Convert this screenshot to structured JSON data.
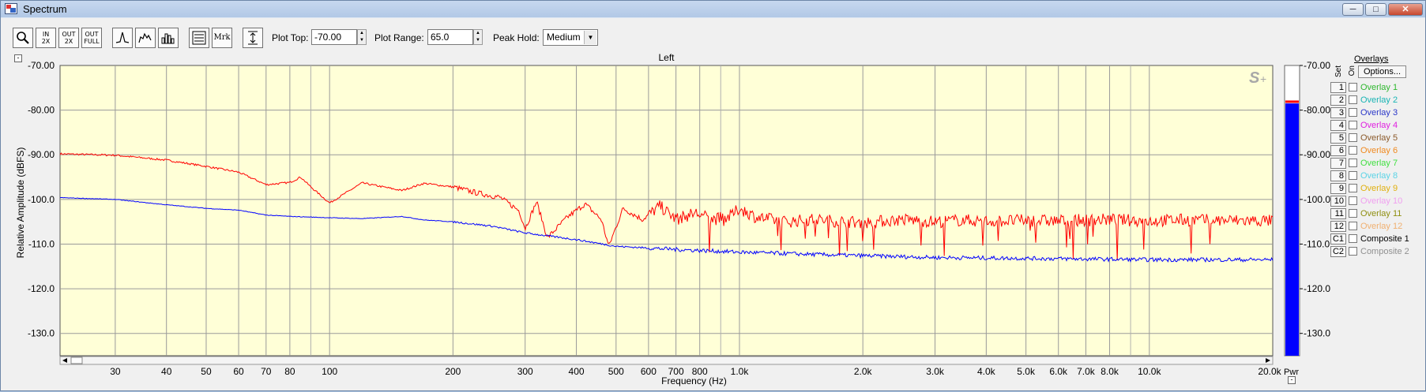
{
  "window": {
    "title": "Spectrum"
  },
  "toolbar": {
    "zoom_in_2x": "IN\n2X",
    "zoom_out_2x": "OUT\n2X",
    "zoom_out_full": "OUT\nFULL",
    "marker_label": "Mrk",
    "plot_top_label": "Plot Top:",
    "plot_top_value": "-70.00",
    "plot_range_label": "Plot Range:",
    "plot_range_value": "65.0",
    "peak_hold_label": "Peak Hold:",
    "peak_hold_value": "Medium"
  },
  "meter": {
    "label": "Pwr",
    "level_db": -78.5,
    "peak_db": -78.2
  },
  "overlays_panel": {
    "title": "Overlays",
    "options_label": "Options...",
    "set_label": "Set",
    "on_label": "On",
    "items": [
      {
        "num": "1",
        "label": "Overlay 1",
        "color": "#2fb82f"
      },
      {
        "num": "2",
        "label": "Overlay 2",
        "color": "#19b4b4"
      },
      {
        "num": "3",
        "label": "Overlay 3",
        "color": "#2a37c8"
      },
      {
        "num": "4",
        "label": "Overlay 4",
        "color": "#e020e0"
      },
      {
        "num": "5",
        "label": "Overlay 5",
        "color": "#8b5a2b"
      },
      {
        "num": "6",
        "label": "Overlay 6",
        "color": "#f08a20"
      },
      {
        "num": "7",
        "label": "Overlay 7",
        "color": "#40e040"
      },
      {
        "num": "8",
        "label": "Overlay 8",
        "color": "#5ad3e6"
      },
      {
        "num": "9",
        "label": "Overlay 9",
        "color": "#e0b010"
      },
      {
        "num": "10",
        "label": "Overlay 10",
        "color": "#f0a0f0"
      },
      {
        "num": "11",
        "label": "Overlay 11",
        "color": "#8f8f10"
      },
      {
        "num": "12",
        "label": "Overlay 12",
        "color": "#f0b070"
      },
      {
        "num": "C1",
        "label": "Composite 1",
        "color": "#000000"
      },
      {
        "num": "C2",
        "label": "Composite 2",
        "color": "#909090"
      }
    ]
  },
  "chart_data": {
    "type": "line",
    "title": "Left",
    "xlabel": "Frequency (Hz)",
    "ylabel": "Relative Amplitude (dBFS)",
    "x_scale": "log",
    "xlim": [
      22,
      20000
    ],
    "ylim": [
      -135,
      -70
    ],
    "grid": true,
    "y_ticks": [
      -70,
      -80,
      -90,
      -100,
      -110,
      -120,
      -130
    ],
    "y_tick_labels": [
      "-70.00",
      "-80.00",
      "-90.00",
      "-100.0",
      "-110.0",
      "-120.0",
      "-130.0"
    ],
    "x_ticks": [
      30,
      40,
      50,
      60,
      70,
      80,
      100,
      200,
      300,
      400,
      500,
      600,
      700,
      800,
      1000,
      2000,
      3000,
      4000,
      5000,
      6000,
      7000,
      8000,
      10000,
      20000
    ],
    "x_tick_labels": [
      "30",
      "40",
      "50",
      "60",
      "70",
      "80",
      "100",
      "200",
      "300",
      "400",
      "500",
      "600",
      "700",
      "800",
      "1.0k",
      "2.0k",
      "3.0k",
      "4.0k",
      "5.0k",
      "6.0k",
      "7.0k",
      "8.0k",
      "10.0k",
      "20.0k"
    ],
    "minor_x": [
      90,
      900,
      9000
    ],
    "meter_ticks": [
      "-70.00",
      "-80.00",
      "-90.00",
      "-100.0",
      "-110.0",
      "-120.0",
      "-130.0"
    ],
    "series": [
      {
        "color": "#ff0000",
        "x": [
          22,
          30,
          40,
          50,
          60,
          70,
          80,
          85,
          90,
          100,
          120,
          150,
          170,
          200,
          230,
          260,
          290,
          300,
          320,
          340,
          380,
          420,
          460,
          480,
          520,
          580,
          640,
          700,
          780,
          860,
          950,
          1000,
          1100,
          1300,
          1500,
          1700,
          2000,
          2500,
          3000,
          3500,
          4000,
          5000,
          6000,
          8000,
          10000,
          12000,
          15000,
          20000
        ],
        "y": [
          -89.8,
          -90.1,
          -91.2,
          -92.6,
          -93.9,
          -96.7,
          -96.2,
          -95.0,
          -97.2,
          -100.8,
          -96.3,
          -98.0,
          -96.4,
          -97.2,
          -98.6,
          -99.5,
          -102.5,
          -106.5,
          -100.5,
          -108.6,
          -104.0,
          -101.0,
          -104.5,
          -110.5,
          -102.0,
          -104.5,
          -101.5,
          -104.5,
          -103.0,
          -104.5,
          -103.8,
          -102.0,
          -104.0,
          -105.0,
          -104.5,
          -104.8,
          -105.2,
          -104.5,
          -105.0,
          -104.6,
          -104.9,
          -104.7,
          -104.8,
          -104.5,
          -104.8,
          -104.6,
          -104.7,
          -104.8
        ],
        "noise": 1.4
      },
      {
        "color": "#0000ff",
        "x": [
          22,
          30,
          40,
          50,
          60,
          70,
          80,
          100,
          120,
          150,
          170,
          200,
          250,
          300,
          400,
          500,
          700,
          1000,
          1500,
          2000,
          3000,
          5000,
          10000,
          20000
        ],
        "y": [
          -99.6,
          -100.0,
          -101.2,
          -102.0,
          -102.4,
          -103.5,
          -103.8,
          -104.1,
          -104.3,
          -103.8,
          -104.6,
          -105.0,
          -106.0,
          -107.5,
          -109.0,
          -110.5,
          -111.2,
          -111.8,
          -112.3,
          -112.6,
          -113.0,
          -113.2,
          -113.5,
          -113.5
        ],
        "noise": 0.45
      }
    ]
  }
}
